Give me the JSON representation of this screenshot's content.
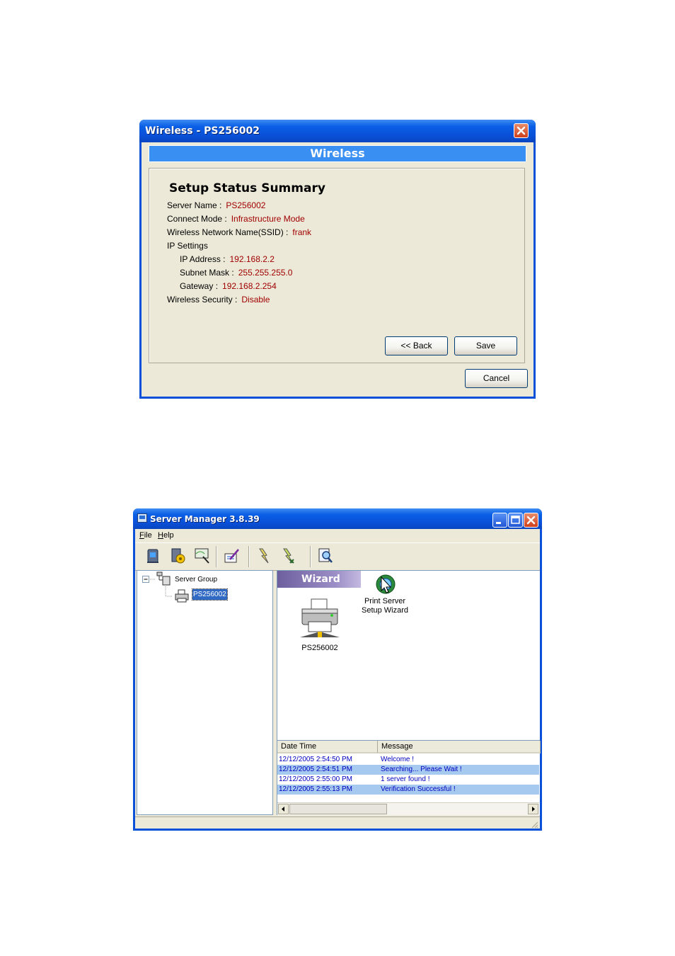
{
  "wireless_dialog": {
    "title": "Wireless - PS256002",
    "header": "Wireless",
    "summary_title": "Setup Status Summary",
    "fields": [
      {
        "label": "Server Name :",
        "value": "PS256002"
      },
      {
        "label": "Connect Mode :",
        "value": "Infrastructure Mode"
      },
      {
        "label": "Wireless Network Name(SSID) :",
        "value": "frank"
      },
      {
        "label": "IP Settings",
        "value": ""
      },
      {
        "label": "IP Address :",
        "value": "192.168.2.2"
      },
      {
        "label": "Subnet Mask :",
        "value": "255.255.255.0"
      },
      {
        "label": "Gateway :",
        "value": "192.168.2.254"
      },
      {
        "label": "Wireless Security :",
        "value": "Disable"
      }
    ],
    "back_label": "<< Back",
    "save_label": "Save",
    "cancel_label": "Cancel",
    "value_color": "#a00000",
    "header_color": "#3a8ff3"
  },
  "server_manager": {
    "title": "Server Manager 3.8.39",
    "menu": [
      "File",
      "Help"
    ],
    "toolbar_icons": [
      "server-icon",
      "settings-server-icon",
      "search-network-icon",
      "edit-config-icon",
      "connect-icon",
      "disconnect-icon",
      "find-icon"
    ],
    "tree": {
      "root": "Server Group",
      "child": "PS256002"
    },
    "wizard_tab": "Wizard",
    "icons": [
      {
        "label": "PS256002",
        "icon": "printer-icon"
      },
      {
        "label_line1": "Print Server",
        "label_line2": "Setup Wizard",
        "icon": "wizard-icon"
      }
    ],
    "log": {
      "columns": [
        "Date Time",
        "Message"
      ],
      "rows": [
        {
          "time": "12/12/2005 2:54:50 PM",
          "message": "Welcome !"
        },
        {
          "time": "12/12/2005 2:54:51 PM",
          "message": "Searching... Please Wait !"
        },
        {
          "time": "12/12/2005 2:55:00 PM",
          "message": "1 server found !"
        },
        {
          "time": "12/12/2005 2:55:13 PM",
          "message": "Verification Successful !"
        }
      ]
    }
  }
}
